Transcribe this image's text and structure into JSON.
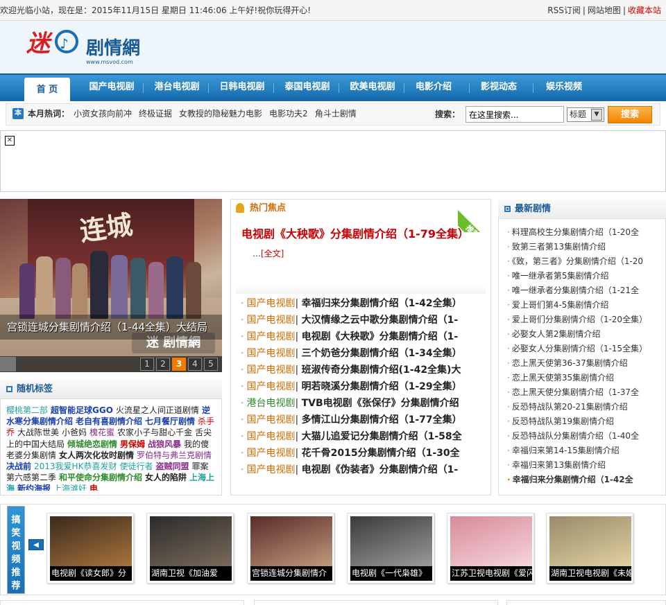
{
  "topbar": {
    "welcome": "欢迎光临小站，现在是：2015年11月15日 星期日 11:46:06 上午好!祝你玩得开心!",
    "links": [
      "RSS订阅",
      "网站地图",
      "收藏本站"
    ]
  },
  "logo": {
    "text": "剧情網",
    "sub": "www.msvod.com"
  },
  "nav": {
    "home": "首 页",
    "items": [
      "国产电视剧",
      "港台电视剧",
      "日韩电视剧",
      "泰国电视剧",
      "欧美电视剧",
      "电影介绍",
      "影视动态",
      "娱乐视频"
    ]
  },
  "hotbar": {
    "icon": "本",
    "label": "本月热词：",
    "links": [
      "小资女孩向前冲",
      "终极证据",
      "女教授的隐秘魅力电影",
      "电影功夫2",
      "角斗士剧情"
    ],
    "search_label": "搜索：",
    "search_placeholder": "在这里搜索...",
    "select_value": "标题",
    "search_button": "搜索"
  },
  "slide": {
    "caption": "宫锁连城分集剧情介绍（1-44全集）大结局",
    "pages": [
      "1",
      "2",
      "3",
      "4",
      "5"
    ],
    "active_page": "3",
    "poster_title": "连城"
  },
  "hotfocus": {
    "title": "热门焦点",
    "ribbon": "推荐",
    "headline": "电视剧《大秧歌》分集剧情介绍（1-79全集）",
    "more_prefix": "…",
    "more_link": "[全文]",
    "items": [
      {
        "cat": "国产电视剧",
        "title": "幸福归来分集剧情介绍（1-42全集）"
      },
      {
        "cat": "国产电视剧",
        "title": "大汉情缘之云中歌分集剧情介绍（1-"
      },
      {
        "cat": "国产电视剧",
        "title": "电视剧《大秧歌》分集剧情介绍（1-"
      },
      {
        "cat": "国产电视剧",
        "title": "三个奶爸分集剧情介绍（1-34全集）"
      },
      {
        "cat": "国产电视剧",
        "title": "班淑传奇分集剧情介绍(1-42全集)大"
      },
      {
        "cat": "国产电视剧",
        "title": "明若晓溪分集剧情介绍（1-29全集）"
      },
      {
        "cat": "港台电视剧",
        "title": "TVB电视剧《张保仔》分集剧情介绍"
      },
      {
        "cat": "国产电视剧",
        "title": "多情江山分集剧情介绍（1-77全集）"
      },
      {
        "cat": "国产电视剧",
        "title": "大猫儿追爱记分集剧情介绍（1-58全"
      },
      {
        "cat": "国产电视剧",
        "title": "花千骨2015分集剧情介绍（1-30全"
      },
      {
        "cat": "国产电视剧",
        "title": "电视剧《伪装者》分集剧情介绍（1-"
      }
    ]
  },
  "latest": {
    "title": "最新剧情",
    "items": [
      "料理高校生分集剧情介绍（1-20全",
      "致第三者第13集剧情介绍",
      "《致，第三者》分集剧情介绍（1-20",
      "唯一继承者第5集剧情介绍",
      "唯一继承者分集剧情介绍（1-21全",
      "爱上哥们第4-5集剧情介绍",
      "爱上哥们分集剧情介绍（1-20全集）",
      "必娶女人第2集剧情介绍",
      "必娶女人分集剧情介绍（1-15全集）",
      "恋上黑天使第36-37集剧情介绍",
      "恋上黑天使第35集剧情介绍",
      "恋上黑天使分集剧情介绍（1-37全",
      "反恐特战队第20-21集剧情介绍",
      "反恐特战队第19集剧情介绍",
      "反恐特战队分集剧情介绍（1-40全",
      "幸福归来第14-15集剧情介绍",
      "幸福归来第13集剧情介绍",
      "幸福归来分集剧情介绍（1-42全"
    ]
  },
  "tags": {
    "title": "随机标签",
    "items": [
      {
        "t": "樱桃第二部",
        "c": "#1fa0a0",
        "b": false
      },
      {
        "t": "超智能足球GGO",
        "c": "#1a3fb0",
        "b": true
      },
      {
        "t": "火流星之人间正道剧情",
        "c": "#222",
        "b": false
      },
      {
        "t": "逆水寒分集剧情介绍",
        "c": "#1a3fb0",
        "b": true
      },
      {
        "t": "老自有喜剧情介绍",
        "c": "#1a3fb0",
        "b": true
      },
      {
        "t": "七月餐厅剧情",
        "c": "#1a3fb0",
        "b": true
      },
      {
        "t": "杀手乔",
        "c": "#c00",
        "b": false
      },
      {
        "t": "大战陈世美",
        "c": "#222",
        "b": false
      },
      {
        "t": "小爸妈",
        "c": "#222",
        "b": false
      },
      {
        "t": "槐花蜜",
        "c": "#8a2a8a",
        "b": false
      },
      {
        "t": "农家小子与甜心千金",
        "c": "#222",
        "b": false
      },
      {
        "t": "舌尖上的中国大结局",
        "c": "#222",
        "b": false
      },
      {
        "t": "倾城绝恋剧情",
        "c": "#2d8a2d",
        "b": true
      },
      {
        "t": "男保姆",
        "c": "#c00",
        "b": true
      },
      {
        "t": "战狼风暴",
        "c": "#8a2a8a",
        "b": true
      },
      {
        "t": "我的傻老婆分集剧情",
        "c": "#222",
        "b": false
      },
      {
        "t": "女人两次化妆时剧情",
        "c": "#222",
        "b": true
      },
      {
        "t": "罗伯特与弗兰克剧情",
        "c": "#8a2a8a",
        "b": false
      },
      {
        "t": "决战前",
        "c": "#1a3fb0",
        "b": true
      },
      {
        "t": "2013我爱HK恭喜发财",
        "c": "#1fa0a0",
        "b": false
      },
      {
        "t": "使徒行者",
        "c": "#1fa0a0",
        "b": false
      },
      {
        "t": "盗贼同盟",
        "c": "#8a2a8a",
        "b": true
      },
      {
        "t": "罪案第六感第二季",
        "c": "#222",
        "b": false
      },
      {
        "t": "和平使命分集剧情介绍",
        "c": "#2d8a2d",
        "b": true
      },
      {
        "t": "女人的陷阱",
        "c": "#222",
        "b": true
      },
      {
        "t": "上海上海",
        "c": "#1fa0a0",
        "b": true
      },
      {
        "t": "新约海报",
        "c": "#1a3fb0",
        "b": true
      },
      {
        "t": "上海滩奸",
        "c": "#1fa0a0",
        "b": false
      },
      {
        "t": "电",
        "c": "#c00",
        "b": true
      }
    ]
  },
  "videos": {
    "label": "搞笑视频推荐",
    "prev": "◀",
    "items": [
      {
        "cap": "电视剧《读女郎》分",
        "c1": "#3a2a1e",
        "c2": "#a8743a"
      },
      {
        "cap": "湖南卫视《加油爱",
        "c1": "#2b2b2b",
        "c2": "#7a6a5a"
      },
      {
        "cap": "宫锁连城分集剧情介",
        "c1": "#5a2a2a",
        "c2": "#c09a7a"
      },
      {
        "cap": "电视剧《一代枭雄》",
        "c1": "#3a3a3a",
        "c2": "#9a9a9a"
      },
      {
        "cap": "江苏卫视电视剧《爱闪",
        "c1": "#d88a9a",
        "c2": "#f5d5dc"
      },
      {
        "cap": "湖南卫视电视剧《未婚",
        "c1": "#9a8a6a",
        "c2": "#e0d0a0"
      }
    ]
  },
  "colors": {
    "nav": "#1268ab",
    "accent": "#d36a00",
    "headline": "#cc0000",
    "search_btn": "#f28300"
  }
}
